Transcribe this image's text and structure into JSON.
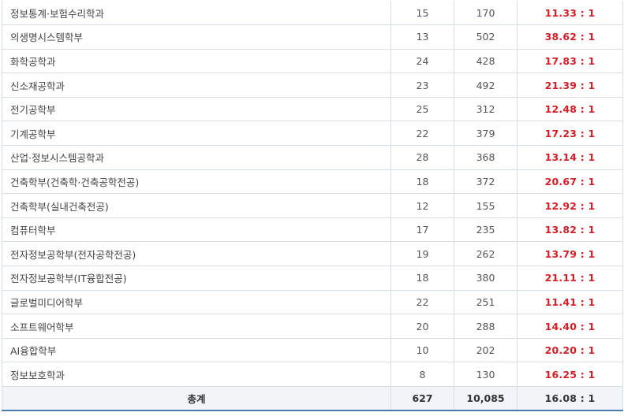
{
  "rows": [
    {
      "dept": "정보통계·보험수리학과",
      "quota": "15",
      "applicants": "170",
      "rate": "11.33 : 1"
    },
    {
      "dept": "의생명시스템학부",
      "quota": "13",
      "applicants": "502",
      "rate": "38.62 : 1"
    },
    {
      "dept": "화학공학과",
      "quota": "24",
      "applicants": "428",
      "rate": "17.83 : 1"
    },
    {
      "dept": "신소재공학과",
      "quota": "23",
      "applicants": "492",
      "rate": "21.39 : 1"
    },
    {
      "dept": "전기공학부",
      "quota": "25",
      "applicants": "312",
      "rate": "12.48 : 1"
    },
    {
      "dept": "기계공학부",
      "quota": "22",
      "applicants": "379",
      "rate": "17.23 : 1"
    },
    {
      "dept": "산업·정보시스템공학과",
      "quota": "28",
      "applicants": "368",
      "rate": "13.14 : 1"
    },
    {
      "dept": "건축학부(건축학·건축공학전공)",
      "quota": "18",
      "applicants": "372",
      "rate": "20.67 : 1"
    },
    {
      "dept": "건축학부(실내건축전공)",
      "quota": "12",
      "applicants": "155",
      "rate": "12.92 : 1"
    },
    {
      "dept": "컴퓨터학부",
      "quota": "17",
      "applicants": "235",
      "rate": "13.82 : 1"
    },
    {
      "dept": "전자정보공학부(전자공학전공)",
      "quota": "19",
      "applicants": "262",
      "rate": "13.79 : 1"
    },
    {
      "dept": "전자정보공학부(IT융합전공)",
      "quota": "18",
      "applicants": "380",
      "rate": "21.11 : 1"
    },
    {
      "dept": "글로벌미디어학부",
      "quota": "22",
      "applicants": "251",
      "rate": "11.41 : 1"
    },
    {
      "dept": "소프트웨어학부",
      "quota": "20",
      "applicants": "288",
      "rate": "14.40 : 1"
    },
    {
      "dept": "AI융합학부",
      "quota": "10",
      "applicants": "202",
      "rate": "20.20 : 1"
    },
    {
      "dept": "정보보호학과",
      "quota": "8",
      "applicants": "130",
      "rate": "16.25 : 1"
    }
  ],
  "total": {
    "label": "총계",
    "quota": "627",
    "applicants": "10,085",
    "rate": "16.08 : 1"
  },
  "colors": {
    "rate_highlight": "#d81e24",
    "border": "#d6dee6",
    "total_bg": "#f2f5f8",
    "total_bottom_line": "#4a7bb0"
  }
}
